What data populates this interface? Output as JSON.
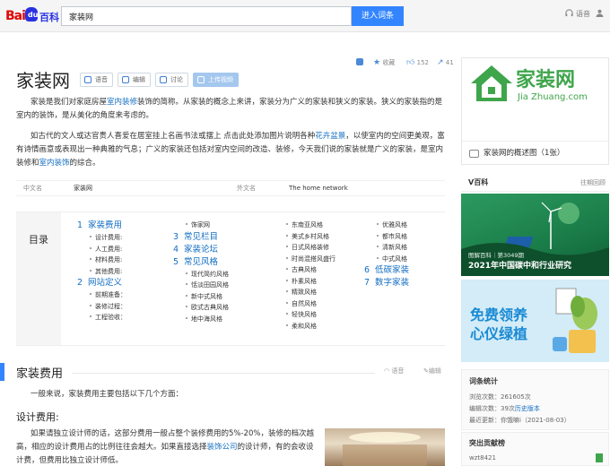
{
  "header": {
    "logo_text_bai": "Bai",
    "logo_text_du": "du",
    "logo_text_baike": "百科",
    "search_value": "家装网",
    "search_button": "进入词条",
    "right_items": [
      "语音"
    ]
  },
  "title": "家装网",
  "chips": [
    {
      "label": "语音",
      "icon": "speaker-icon"
    },
    {
      "label": "编辑",
      "icon": "edit-icon"
    },
    {
      "label": "讨论",
      "icon": "comment-icon"
    },
    {
      "label": "上传视频",
      "icon": "upload-icon"
    }
  ],
  "actions": {
    "collect_label": "收藏",
    "like_count": "152",
    "share_count": "41"
  },
  "intro": {
    "p1_a": "家装是我们对家庭房屋",
    "p1_link": "室内装修",
    "p1_b": "装饰的简称。从家装的概念上来讲，家装分为广义的家装和狭义的家装。狭义的家装指的是室内的装饰，是从美化的角度来考虑的。",
    "p2_a": "如古代的文人或达官贵人喜爱在居室挂上名画书法或摆上 点击此处添加图片说明各种",
    "p2_link1": "花卉盆景",
    "p2_b": "，以使室内的空间更美观，富有诗情画意或表现出一种典雅的气息；广义的家装还包括对室内空间的改造、装修，今天我们说的家装就是广义的家装，是室内装修和",
    "p2_link2": "室内装饰",
    "p2_c": "的综合。"
  },
  "basic_info": {
    "k1": "中文名",
    "v1": "家装网",
    "k2": "外文名",
    "v2": "The home network"
  },
  "catalog": {
    "label": "目录",
    "col1": [
      {
        "level": 1,
        "num": "1",
        "text": "家装费用"
      },
      {
        "level": 2,
        "text": "设计费用:"
      },
      {
        "level": 2,
        "text": "人工费用:"
      },
      {
        "level": 2,
        "text": "材料费用:"
      },
      {
        "level": 2,
        "text": "其他费用:"
      },
      {
        "level": 1,
        "num": "2",
        "text": "网站定义"
      },
      {
        "level": 2,
        "text": "前期准备："
      },
      {
        "level": 2,
        "text": "装修过程："
      },
      {
        "level": 2,
        "text": "工程验收："
      }
    ],
    "col2": [
      {
        "level": 2,
        "text": "饰家网"
      },
      {
        "level": 1,
        "num": "3",
        "text": "常见栏目"
      },
      {
        "level": 1,
        "num": "4",
        "text": "家装论坛"
      },
      {
        "level": 1,
        "num": "5",
        "text": "常见风格"
      },
      {
        "level": 2,
        "text": "现代简约风格"
      },
      {
        "level": 2,
        "text": "恬淡田园风格"
      },
      {
        "level": 2,
        "text": "新中式风格"
      },
      {
        "level": 2,
        "text": "欧式古典风格"
      },
      {
        "level": 2,
        "text": "地中海风格"
      }
    ],
    "col3": [
      {
        "level": 2,
        "text": "东南亚风格"
      },
      {
        "level": 2,
        "text": "美式乡村风格"
      },
      {
        "level": 2,
        "text": "日式风格装修"
      },
      {
        "level": 2,
        "text": "时尚混搭风盛行"
      },
      {
        "level": 2,
        "text": "古典风格"
      },
      {
        "level": 2,
        "text": "朴素风格"
      },
      {
        "level": 2,
        "text": "精致风格"
      },
      {
        "level": 2,
        "text": "自然风格"
      },
      {
        "level": 2,
        "text": "轻快风格"
      },
      {
        "level": 2,
        "text": "柔和风格"
      }
    ],
    "col4": [
      {
        "level": 2,
        "text": "优雅风格"
      },
      {
        "level": 2,
        "text": "都市风格"
      },
      {
        "level": 2,
        "text": "清新风格"
      },
      {
        "level": 2,
        "text": "中式风格"
      },
      {
        "level": 1,
        "num": "6",
        "text": "低碳家装"
      },
      {
        "level": 1,
        "num": "7",
        "text": "数字家装"
      }
    ]
  },
  "section": {
    "title": "家装费用",
    "voice": "语音",
    "edit": "编辑",
    "intro": "一般来说，家装费用主要包括以下几个方面：",
    "subtitle": "设计费用:",
    "body_a": "如果请独立设计师的话，这部分费用一般占整个装修费用的5%-20%，装修的档次越高，相应的设计费用占的比例往往会越大。如果直接选择",
    "body_link": "装饰公司",
    "body_b": "的设计师，有的会收设计费，但费用比独立设计师低。"
  },
  "sidebar": {
    "logo_cn": "家装网",
    "logo_en": "Jia Zhuang.com",
    "caption": "家装网的概述图（1张）",
    "vbk_title": "V百科",
    "vbk_more": "往期回顾",
    "ad1_top": "图解百科｜第3049期",
    "ad1_main": "2021年中国碳中和行业研究",
    "ad2_line1": "免费领养",
    "ad2_line2": "心仪绿植",
    "stats_title": "词条统计",
    "stats": [
      {
        "k": "浏览次数：",
        "v": "261605次"
      },
      {
        "k": "编辑次数：",
        "v": "39次",
        "link": "历史版本"
      },
      {
        "k": "最近更新：",
        "v": "你饿嘛i（2021-08-03）"
      }
    ],
    "contrib_title": "突出贡献榜",
    "contrib_user": "wzt8421"
  },
  "colors": {
    "accent": "#3385ff",
    "link": "#136ec2",
    "logo_green": "#3fa54b"
  }
}
